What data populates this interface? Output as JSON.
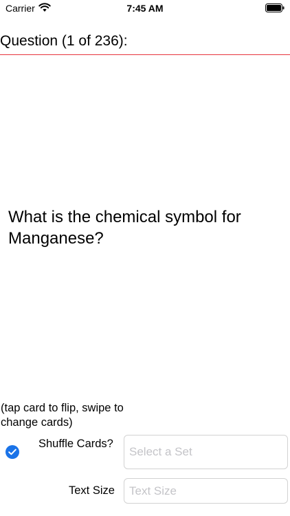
{
  "status_bar": {
    "carrier": "Carrier",
    "time": "7:45 AM",
    "icons": [
      "wifi-icon",
      "battery-icon"
    ]
  },
  "header": {
    "question_title": "Question (1 of 236):",
    "divider_color": "#e8323c"
  },
  "card": {
    "text": "What is the chemical symbol for Manganese?"
  },
  "hint": "(tap card to flip, swipe to change cards)",
  "shuffle": {
    "label": "Shuffle Cards?",
    "checked": true,
    "check_color": "#1a73e8"
  },
  "set_select": {
    "placeholder": "Select a Set",
    "value": ""
  },
  "text_size": {
    "label": "Text Size",
    "placeholder": "Text Size",
    "value": ""
  }
}
